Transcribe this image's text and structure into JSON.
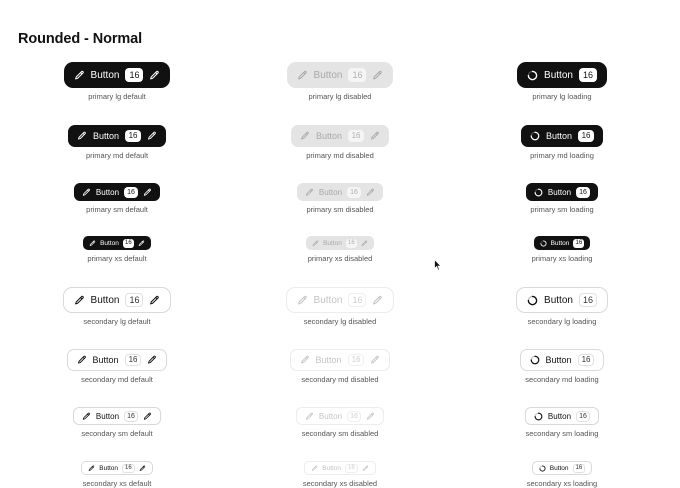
{
  "page": {
    "section_title": "Rounded - Normal"
  },
  "button_label": "Button",
  "badge_count": "16",
  "colors": {
    "primary": "#111111",
    "disabled_bg": "#e4e4e4",
    "secondary_border": "#d9d9d9"
  },
  "columns": [
    {
      "state": "default",
      "buttons": [
        {
          "variant": "primary",
          "size": "lg",
          "caption": "primary lg default"
        },
        {
          "variant": "primary",
          "size": "md",
          "caption": "primary md default"
        },
        {
          "variant": "primary",
          "size": "sm",
          "caption": "primary sm default"
        },
        {
          "variant": "primary",
          "size": "xs",
          "caption": "primary xs default"
        },
        {
          "variant": "secondary",
          "size": "lg",
          "caption": "secondary lg default"
        },
        {
          "variant": "secondary",
          "size": "md",
          "caption": "secondary md default"
        },
        {
          "variant": "secondary",
          "size": "sm",
          "caption": "secondary sm default"
        },
        {
          "variant": "secondary",
          "size": "xs",
          "caption": "secondary xs default"
        }
      ]
    },
    {
      "state": "disabled",
      "buttons": [
        {
          "variant": "primary",
          "size": "lg",
          "caption": "primary lg disabled"
        },
        {
          "variant": "primary",
          "size": "md",
          "caption": "primary md disabled"
        },
        {
          "variant": "primary",
          "size": "sm",
          "caption": "primary sm disabled"
        },
        {
          "variant": "primary",
          "size": "xs",
          "caption": "primary xs disabled"
        },
        {
          "variant": "secondary",
          "size": "lg",
          "caption": "secondary lg disabled"
        },
        {
          "variant": "secondary",
          "size": "md",
          "caption": "secondary md disabled"
        },
        {
          "variant": "secondary",
          "size": "sm",
          "caption": "secondary sm disabled"
        },
        {
          "variant": "secondary",
          "size": "xs",
          "caption": "secondary xs disabled"
        }
      ]
    },
    {
      "state": "loading",
      "buttons": [
        {
          "variant": "primary",
          "size": "lg",
          "caption": "primary lg loading"
        },
        {
          "variant": "primary",
          "size": "md",
          "caption": "primary md loading"
        },
        {
          "variant": "primary",
          "size": "sm",
          "caption": "primary sm loading"
        },
        {
          "variant": "primary",
          "size": "xs",
          "caption": "primary xs loading"
        },
        {
          "variant": "secondary",
          "size": "lg",
          "caption": "secondary lg loading"
        },
        {
          "variant": "secondary",
          "size": "md",
          "caption": "secondary md loading"
        },
        {
          "variant": "secondary",
          "size": "sm",
          "caption": "secondary sm loading"
        },
        {
          "variant": "secondary",
          "size": "xs",
          "caption": "secondary xs loading"
        }
      ]
    }
  ],
  "icons": {
    "leading": "pencil-icon",
    "trailing": "pencil-icon",
    "loading": "spinner-icon"
  }
}
